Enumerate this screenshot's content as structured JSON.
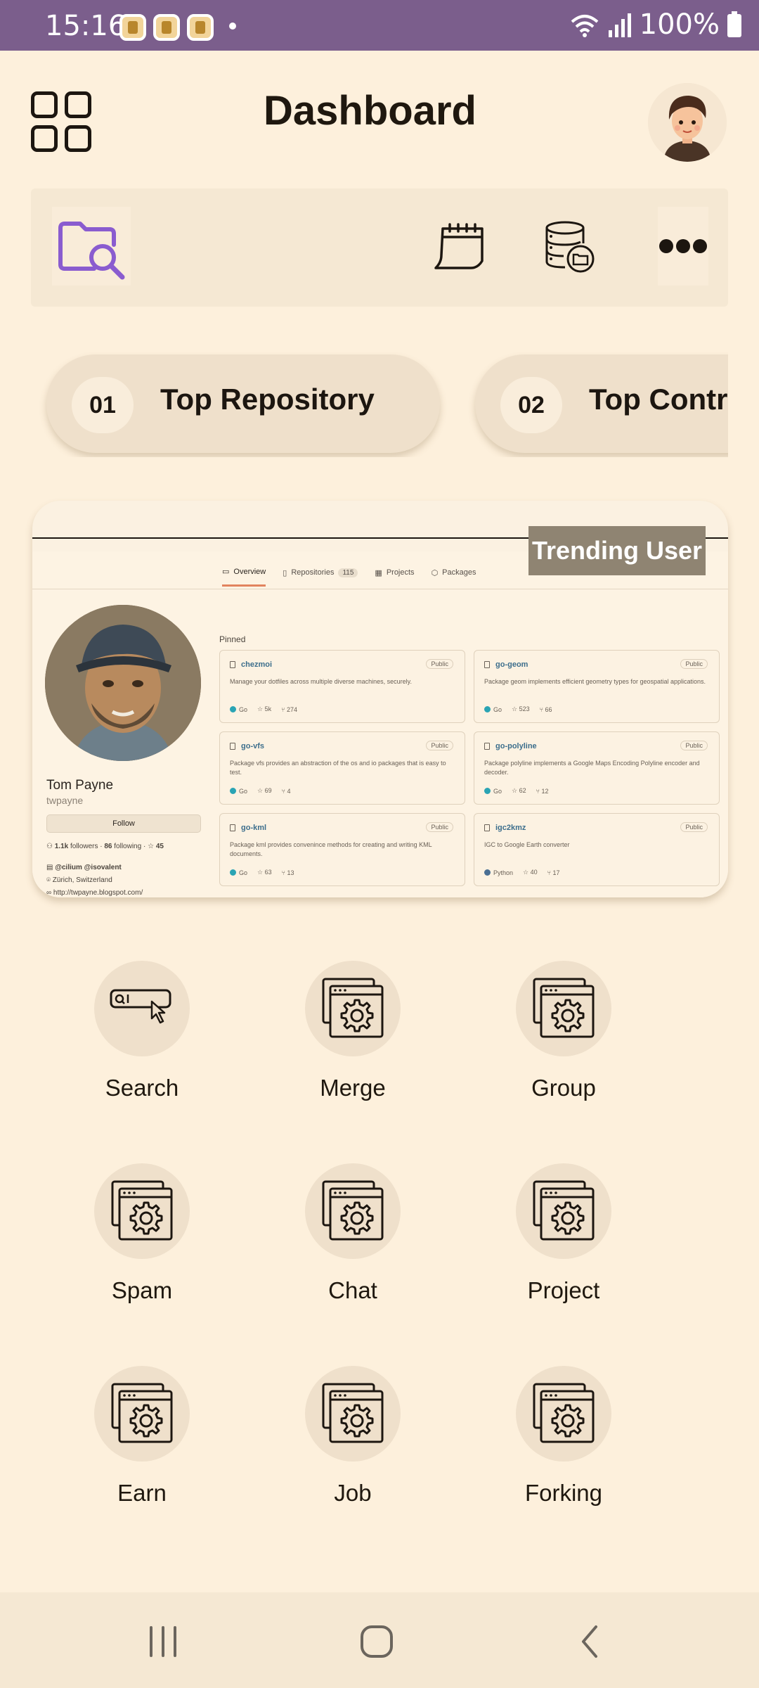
{
  "status_bar": {
    "time": "15:16",
    "battery_text": "100%"
  },
  "header": {
    "title": "Dashboard",
    "menu_icon": "grid-icon",
    "avatar_icon": "user-avatar"
  },
  "toolbar": {
    "items": [
      {
        "icon": "folder-search-icon"
      },
      {
        "icon": "calendar-icon"
      },
      {
        "icon": "database-icon"
      },
      {
        "icon": "more-icon"
      }
    ]
  },
  "pills": [
    {
      "num": "01",
      "label": "Top Repository"
    },
    {
      "num": "02",
      "label": "Top Contrib"
    }
  ],
  "trending": {
    "badge": "Trending User",
    "profile": {
      "name": "Tom Payne",
      "login": "twpayne",
      "follow": "Follow",
      "followers": "1.1k",
      "followers_label": "followers",
      "following": "86",
      "following_label": "following",
      "stars": "45",
      "org": "@cilium @isovalent",
      "location": "Zürich, Switzerland",
      "url": "http://twpayne.blogspot.com/"
    },
    "tabs": {
      "overview": "Overview",
      "repositories": "Repositories",
      "repositories_count": "115",
      "projects": "Projects",
      "packages": "Packages"
    },
    "pinned_label": "Pinned",
    "public_label": "Public",
    "repos": [
      {
        "name": "chezmoi",
        "desc": "Manage your dotfiles across multiple diverse machines, securely.",
        "lang": "Go",
        "lang_color": "#2aa4b4",
        "stars": "5k",
        "forks": "274"
      },
      {
        "name": "go-geom",
        "desc": "Package geom implements efficient geometry types for geospatial applications.",
        "lang": "Go",
        "lang_color": "#2aa4b4",
        "stars": "523",
        "forks": "66"
      },
      {
        "name": "go-vfs",
        "desc": "Package vfs provides an abstraction of the os and io packages that is easy to test.",
        "lang": "Go",
        "lang_color": "#2aa4b4",
        "stars": "69",
        "forks": "4"
      },
      {
        "name": "go-polyline",
        "desc": "Package polyline implements a Google Maps Encoding Polyline encoder and decoder.",
        "lang": "Go",
        "lang_color": "#2aa4b4",
        "stars": "62",
        "forks": "12"
      },
      {
        "name": "go-kml",
        "desc": "Package kml provides convenince methods for creating and writing KML documents.",
        "lang": "Go",
        "lang_color": "#2aa4b4",
        "stars": "63",
        "forks": "13"
      },
      {
        "name": "igc2kmz",
        "desc": "IGC to Google Earth converter",
        "lang": "Python",
        "lang_color": "#4a6f93",
        "stars": "40",
        "forks": "17"
      }
    ]
  },
  "features": [
    {
      "label": "Search",
      "icon": "search-bar-icon"
    },
    {
      "label": "Merge",
      "icon": "browser-gear-icon"
    },
    {
      "label": "Group",
      "icon": "browser-gear-icon"
    },
    {
      "label": "Spam",
      "icon": "browser-gear-icon"
    },
    {
      "label": "Chat",
      "icon": "browser-gear-icon"
    },
    {
      "label": "Project",
      "icon": "browser-gear-icon"
    },
    {
      "label": "Earn",
      "icon": "browser-gear-icon"
    },
    {
      "label": "Job",
      "icon": "browser-gear-icon"
    },
    {
      "label": "Forking",
      "icon": "browser-gear-icon"
    }
  ],
  "nav": {
    "recents_icon": "recents-icon",
    "home_icon": "home-icon",
    "back_icon": "back-icon"
  },
  "colors": {
    "background": "#fdf0dc",
    "status_bar": "#7b5e8c",
    "accent_purple": "#8a5ccf",
    "badge": "#8f8472"
  }
}
